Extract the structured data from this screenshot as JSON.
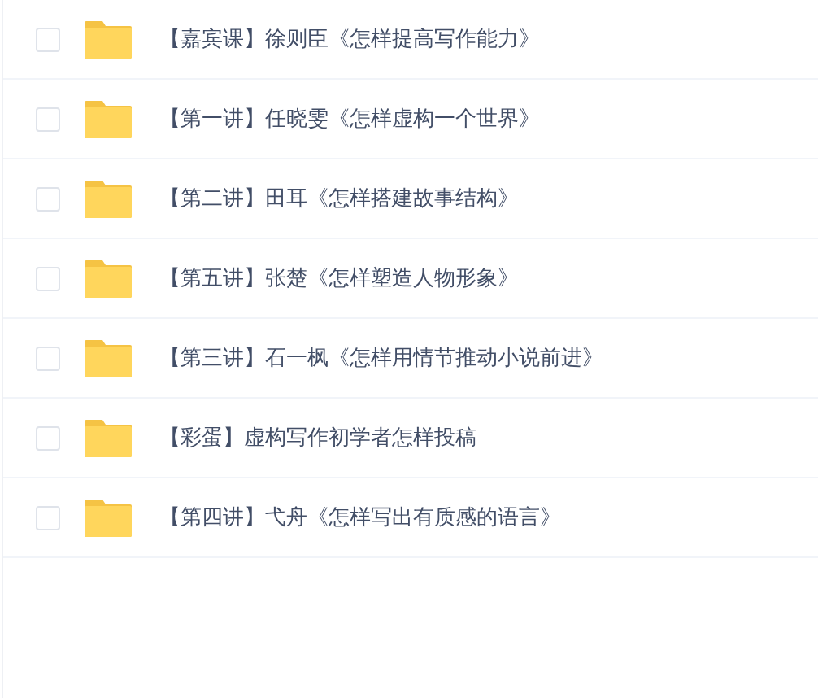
{
  "files": [
    {
      "name": "【嘉宾课】徐则臣《怎样提高写作能力》",
      "checked": false
    },
    {
      "name": "【第一讲】任晓雯《怎样虚构一个世界》",
      "checked": false
    },
    {
      "name": "【第二讲】田耳《怎样搭建故事结构》",
      "checked": false
    },
    {
      "name": "【第五讲】张楚《怎样塑造人物形象》",
      "checked": false
    },
    {
      "name": "【第三讲】石一枫《怎样用情节推动小说前进》",
      "checked": false
    },
    {
      "name": "【彩蛋】虚构写作初学者怎样投稿",
      "checked": false
    },
    {
      "name": "【第四讲】弋舟《怎样写出有质感的语言》",
      "checked": false
    }
  ]
}
